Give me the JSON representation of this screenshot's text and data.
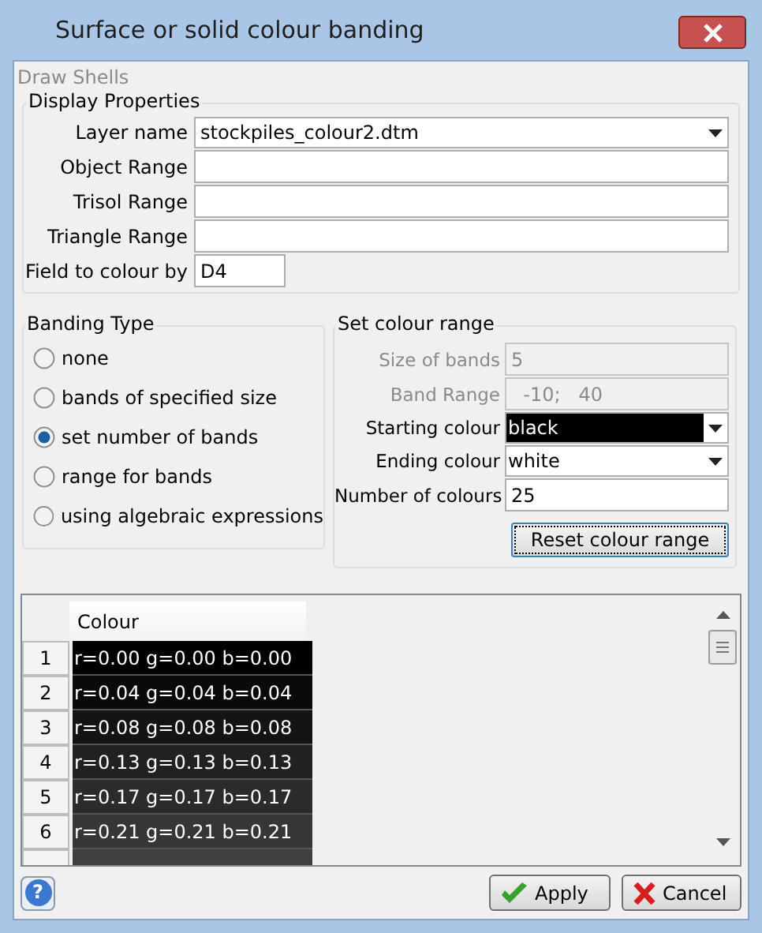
{
  "window": {
    "title": "Surface or solid colour banding"
  },
  "section_title": "Draw Shells",
  "display_properties": {
    "title": "Display Properties",
    "fields": [
      {
        "kind": "dropdown",
        "label": "Layer name",
        "value": "stockpiles_colour2.dtm"
      },
      {
        "kind": "text",
        "label": "Object Range"
      },
      {
        "kind": "text",
        "label": "Trisol Range"
      },
      {
        "kind": "text",
        "label": "Triangle Range"
      },
      {
        "kind": "short",
        "label": "Field to colour by",
        "value": "D4"
      }
    ]
  },
  "banding_type": {
    "title": "Banding Type",
    "options": [
      {
        "label": "none",
        "selected": false
      },
      {
        "label": "bands of specified size",
        "selected": false
      },
      {
        "label": "set number of bands",
        "selected": true
      },
      {
        "label": "range for bands",
        "selected": false
      },
      {
        "label": "using algebraic expressions",
        "selected": false
      }
    ]
  },
  "colour_range": {
    "title": "Set colour range",
    "fields": [
      {
        "kind": "text",
        "label": "Size of bands",
        "value": "5",
        "disabled": true
      },
      {
        "kind": "text",
        "label": "Band Range",
        "value": "  -10;   40",
        "disabled": true
      },
      {
        "kind": "dropdown",
        "label": "Starting colour",
        "value": "black",
        "color": "#000000",
        "disabled": false
      },
      {
        "kind": "dropdown",
        "label": "Ending colour",
        "value": "white",
        "color": "#ffffff",
        "disabled": false
      },
      {
        "kind": "text",
        "label": "Number of colours",
        "value": "25",
        "disabled": false
      }
    ],
    "reset_button": "Reset colour range"
  },
  "table": {
    "columns": [
      "Colour"
    ],
    "rows": [
      {
        "number": "1",
        "value": "r=0.00 g=0.00 b=0.00",
        "color": "#000000"
      },
      {
        "number": "2",
        "value": "r=0.04 g=0.04 b=0.04",
        "color": "#0a0a0a"
      },
      {
        "number": "3",
        "value": "r=0.08 g=0.08 b=0.08",
        "color": "#141414"
      },
      {
        "number": "4",
        "value": "r=0.13 g=0.13 b=0.13",
        "color": "#212121"
      },
      {
        "number": "5",
        "value": "r=0.17 g=0.17 b=0.17",
        "color": "#2b2b2b"
      },
      {
        "number": "6",
        "value": "r=0.21 g=0.21 b=0.21",
        "color": "#363636"
      },
      {
        "color": "#3f3f3f"
      }
    ]
  },
  "help_button": "?",
  "buttons": [
    {
      "kind": "apply",
      "label": "Apply"
    },
    {
      "kind": "cancel",
      "label": "Cancel"
    }
  ]
}
